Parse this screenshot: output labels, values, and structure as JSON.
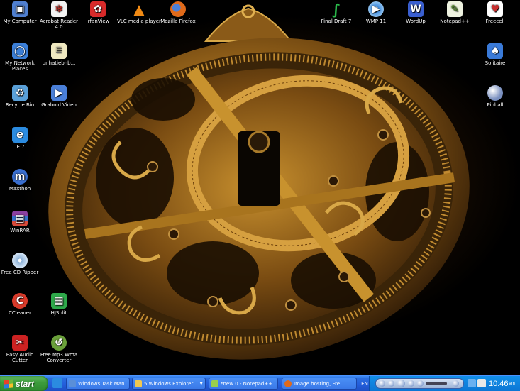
{
  "desktop": {
    "icons": [
      {
        "label": "My Computer",
        "icon": "computer-icon",
        "color": "#4f7fd0"
      },
      {
        "label": "My Network Places",
        "icon": "network-icon",
        "color": "#3b7fd8"
      },
      {
        "label": "Recycle Bin",
        "icon": "recycle-bin-icon",
        "color": "#5aa0d8"
      },
      {
        "label": "IE 7",
        "icon": "ie-icon",
        "color": "#2b8be0"
      },
      {
        "label": "Maxthon",
        "icon": "maxthon-icon",
        "color": "#3a6fd0"
      },
      {
        "label": "WinRAR",
        "icon": "winrar-icon",
        "color": "#8a3fa0"
      },
      {
        "label": "Free CD Ripper",
        "icon": "cd-icon",
        "color": "#8ab0d8"
      },
      {
        "label": "CCleaner",
        "icon": "ccleaner-icon",
        "color": "#d83a2a"
      },
      {
        "label": "Easy Audio Cutter",
        "icon": "audio-cutter-icon",
        "color": "#cc2222"
      },
      {
        "label": "Acrobat Reader 4.0",
        "icon": "acrobat-icon",
        "color": "#c8281e"
      },
      {
        "label": "unhatiebhb...",
        "icon": "file-icon",
        "color": "#d8d0a0"
      },
      {
        "label": "Grabold Video",
        "icon": "video-icon",
        "color": "#4a7fd8"
      },
      {
        "label": "HJSplit",
        "icon": "hjsplit-icon",
        "color": "#2ea84a"
      },
      {
        "label": "Free Mp3 Wma Converter",
        "icon": "converter-icon",
        "color": "#6aa03a"
      },
      {
        "label": "IrfanView",
        "icon": "irfanview-icon",
        "color": "#d82a2a"
      },
      {
        "label": "VLC media player",
        "icon": "vlc-icon",
        "color": "#f08a14"
      },
      {
        "label": "Mozilla Firefox",
        "icon": "firefox-icon",
        "color": "#e06a1a"
      },
      {
        "label": "Final Draft 7",
        "icon": "final-draft-icon",
        "color": "#1a8a3a"
      },
      {
        "label": "WMP 11",
        "icon": "wmp-icon",
        "color": "#3a8ae0"
      },
      {
        "label": "WordUp",
        "icon": "wordup-icon",
        "color": "#3a5fd0"
      },
      {
        "label": "Notepad++",
        "icon": "notepadpp-icon",
        "color": "#9ad04a"
      },
      {
        "label": "Freecell",
        "icon": "freecell-icon",
        "color": "#c83030"
      },
      {
        "label": "Solitaire",
        "icon": "solitaire-icon",
        "color": "#3a7ad8"
      },
      {
        "label": "Pinball",
        "icon": "pinball-icon",
        "color": "#7a90c0"
      }
    ]
  },
  "taskbar": {
    "start_label": "start",
    "tasks": [
      {
        "label": "Windows Task Man...",
        "icon": "task-manager-icon",
        "color": "#5a8fd8"
      },
      {
        "label": "5 Windows Explorer",
        "icon": "folder-icon",
        "color": "#f0c850"
      },
      {
        "label": "*new 0 - Notepad++",
        "icon": "notepadpp-icon",
        "color": "#9ad04a"
      },
      {
        "label": "Image hosting, Fre...",
        "icon": "firefox-icon",
        "color": "#e06a1a"
      }
    ],
    "language": "EN",
    "clock": "10:46",
    "clock_suffix": "am"
  }
}
